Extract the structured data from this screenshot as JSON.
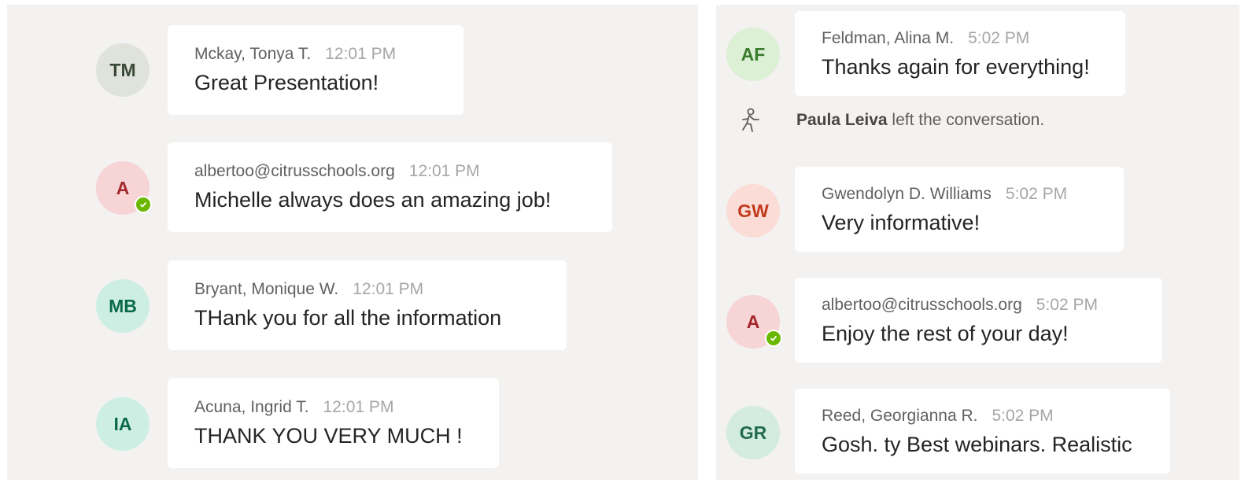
{
  "left_messages": [
    {
      "initials": "TM",
      "sender": "Mckay, Tonya T.",
      "time": "12:01 PM",
      "text": "Great Presentation!",
      "avatar_bg": "#dfe3dc",
      "avatar_fg": "#3a4a37"
    },
    {
      "initials": "A",
      "sender": "albertoo@citrusschools.org",
      "time": "12:01 PM",
      "text": "Michelle always does an amazing job!",
      "avatar_bg": "#f7d4d6",
      "avatar_fg": "#a4262c",
      "status": "available"
    },
    {
      "initials": "MB",
      "sender": "Bryant, Monique W.",
      "time": "12:01 PM",
      "text": "THank you for all the information",
      "avatar_bg": "#cdeee2",
      "avatar_fg": "#0b6a4c"
    },
    {
      "initials": "IA",
      "sender": "Acuna, Ingrid T.",
      "time": "12:01 PM",
      "text": "THANK YOU VERY MUCH !",
      "avatar_bg": "#cdeee2",
      "avatar_fg": "#0b6a4c"
    }
  ],
  "right_messages": [
    {
      "initials": "AF",
      "sender": "Feldman, Alina M.",
      "time": "5:02 PM",
      "text": "Thanks again for everything!",
      "avatar_bg": "#dcf0d5",
      "avatar_fg": "#3c7a2d"
    },
    {
      "initials": "GW",
      "sender": "Gwendolyn D. Williams",
      "time": "5:02 PM",
      "text": "Very informative!",
      "avatar_bg": "#fbdcd6",
      "avatar_fg": "#c23a1e"
    },
    {
      "initials": "A",
      "sender": "albertoo@citrusschools.org",
      "time": "5:02 PM",
      "text": "Enjoy the rest of your day!",
      "avatar_bg": "#f7d4d6",
      "avatar_fg": "#a4262c",
      "status": "available"
    },
    {
      "initials": "GR",
      "sender": "Reed, Georgianna R.",
      "time": "5:02 PM",
      "text": "Gosh. ty  Best webinars.  Realistic",
      "avatar_bg": "#d3ebe0",
      "avatar_fg": "#1f6b4a"
    }
  ],
  "system_event": {
    "name": "Paula Leiva",
    "action": " left the conversation.",
    "icon": "person-leave-icon"
  }
}
